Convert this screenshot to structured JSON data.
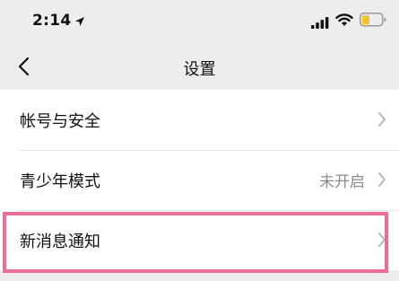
{
  "status_bar": {
    "time": "2:14",
    "icons": [
      "location-arrow-icon",
      "cellular-signal-icon",
      "wifi-icon",
      "battery-icon"
    ],
    "battery_color": "#f4c430"
  },
  "nav": {
    "title": "设置",
    "back_icon": "chevron-left-icon"
  },
  "settings": {
    "items": [
      {
        "label": "帐号与安全",
        "value": ""
      },
      {
        "label": "青少年模式",
        "value": "未开启"
      },
      {
        "label": "新消息通知",
        "value": ""
      }
    ]
  },
  "highlight_color": "#ef6d97"
}
